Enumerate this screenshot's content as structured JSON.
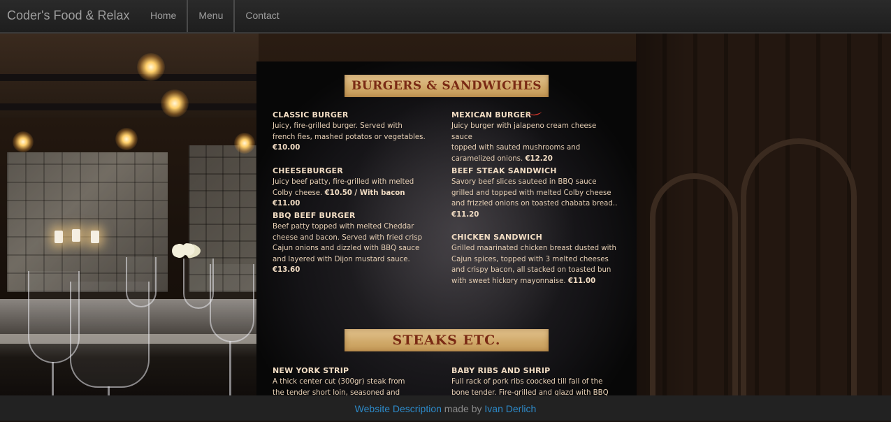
{
  "navbar": {
    "brand": "Coder's Food & Relax",
    "items": [
      "Home",
      "Menu",
      "Contact"
    ]
  },
  "menu": {
    "section1_title": "BURGERS & SANDWICHES",
    "section2_title": "STEAKS ETC.",
    "left_items": [
      {
        "title": "CLASSIC BURGER",
        "lines": [
          "Juicy, fire-grilled burger. Served with",
          "french fies, mashed potatos or vegetables."
        ],
        "price": "€10.00"
      },
      {
        "title": "CHEESEBURGER",
        "lines": [
          "Juicy beef patty, fire-grilled with melted"
        ],
        "last_line": "Colby cheese.",
        "price": "€10.50 / With bacon €11.00"
      },
      {
        "title": "BBQ BEEF BURGER",
        "lines": [
          "Beef patty topped with melted Cheddar",
          "cheese and bacon. Served with fried crisp",
          "Cajun onions and dizzled with BBQ sauce",
          "and layered with Dijon mustard sauce."
        ],
        "price": "€13.60"
      }
    ],
    "right_items": [
      {
        "title": "MEXICAN BURGER",
        "lines": [
          "Juicy burger with jalapeno cream cheese sauce",
          "topped with sauted mushrooms and"
        ],
        "last_line": "caramelized onions.",
        "price": "€12.20"
      },
      {
        "title": "BEEF STEAK SANDWICH",
        "lines": [
          "Savory beef slices sauteed in BBQ sauce",
          "grilled and topped with melted Colby cheese",
          "and frizzled onions on toasted chabata bread.."
        ],
        "price": "€11.20"
      },
      {
        "title": "CHICKEN SANDWICH",
        "lines": [
          "Grilled maarinated chicken breast dusted with",
          "Cajun spices, topped with 3 melted cheeses",
          "and crispy bacon, all stacked on toasted bun"
        ],
        "last_line": "with sweet hickory mayonnaise.",
        "price": "€11.00"
      }
    ],
    "steak_left": {
      "title": "NEW YORK STRIP",
      "lines": [
        "A thick center cut (300gr) steak from",
        "the tender short loin, seasoned and"
      ]
    },
    "steak_right": {
      "title": "BABY RIBS AND SHRIP",
      "lines": [
        "Full rack of pork ribs coocked till fall of the",
        "bone tender. Fire-grilled and glazd with BBQ"
      ]
    },
    "chili_icon": "chili-pepper-icon"
  },
  "footer": {
    "link1": "Website Description",
    "middle": " made by ",
    "link2": "Ivan Derlich"
  },
  "colors": {
    "navbar_bg": "#222222",
    "link": "#2d8ac9",
    "banner": "#cfa868",
    "banner_text": "#7a2a14",
    "menu_text": "#e6cfb4"
  }
}
